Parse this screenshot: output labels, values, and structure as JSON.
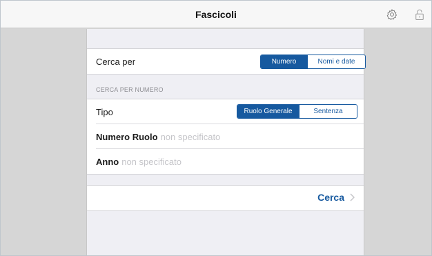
{
  "navbar": {
    "title": "Fascicoli",
    "settings_icon": "gear-icon",
    "lock_icon": "unlock-icon"
  },
  "search_by": {
    "label": "Cerca per",
    "options": [
      "Numero",
      "Nomi e date"
    ],
    "selected": "Numero"
  },
  "section": {
    "header": "CERCA PER NUMERO"
  },
  "tipo": {
    "label": "Tipo",
    "options": [
      "Ruolo Generale",
      "Sentenza"
    ],
    "selected": "Ruolo Generale"
  },
  "numero_ruolo": {
    "label": "Numero Ruolo",
    "placeholder": "non specificato"
  },
  "anno": {
    "label": "Anno",
    "placeholder": "non specificato"
  },
  "action": {
    "label": "Cerca",
    "icon": "chevron-right-icon"
  },
  "colors": {
    "accent": "#16599f",
    "background": "#efeff4",
    "side": "#d6d6d6"
  }
}
